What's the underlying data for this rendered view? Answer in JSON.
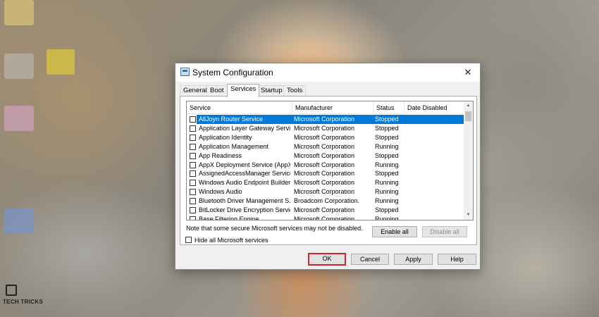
{
  "watermark": {
    "title": "TECH TRICKS",
    "subtitle": ""
  },
  "dialog": {
    "title": "System Configuration",
    "close_glyph": "✕",
    "tabs": [
      "General",
      "Boot",
      "Services",
      "Startup",
      "Tools"
    ],
    "active_tab": "Services",
    "columns": [
      "Service",
      "Manufacturer",
      "Status",
      "Date Disabled"
    ],
    "services": [
      {
        "service": "AllJoyn Router Service",
        "manufacturer": "Microsoft Corporation",
        "status": "Stopped",
        "date_disabled": "",
        "selected": true
      },
      {
        "service": "Application Layer Gateway Service",
        "manufacturer": "Microsoft Corporation",
        "status": "Stopped",
        "date_disabled": ""
      },
      {
        "service": "Application Identity",
        "manufacturer": "Microsoft Corporation",
        "status": "Stopped",
        "date_disabled": ""
      },
      {
        "service": "Application Management",
        "manufacturer": "Microsoft Corporation",
        "status": "Running",
        "date_disabled": ""
      },
      {
        "service": "App Readiness",
        "manufacturer": "Microsoft Corporation",
        "status": "Stopped",
        "date_disabled": ""
      },
      {
        "service": "AppX Deployment Service (AppX...",
        "manufacturer": "Microsoft Corporation",
        "status": "Running",
        "date_disabled": ""
      },
      {
        "service": "AssignedAccessManager Service",
        "manufacturer": "Microsoft Corporation",
        "status": "Stopped",
        "date_disabled": ""
      },
      {
        "service": "Windows Audio Endpoint Builder",
        "manufacturer": "Microsoft Corporation",
        "status": "Running",
        "date_disabled": ""
      },
      {
        "service": "Windows Audio",
        "manufacturer": "Microsoft Corporation",
        "status": "Running",
        "date_disabled": ""
      },
      {
        "service": "Bluetooth Driver Management S...",
        "manufacturer": "Broadcom Corporation.",
        "status": "Running",
        "date_disabled": ""
      },
      {
        "service": "BitLocker Drive Encryption Service",
        "manufacturer": "Microsoft Corporation",
        "status": "Stopped",
        "date_disabled": ""
      },
      {
        "service": "Base Filtering Engine",
        "manufacturer": "Microsoft Corporation",
        "status": "Running",
        "date_disabled": ""
      }
    ],
    "note": "Note that some secure Microsoft services may not be disabled.",
    "enable_all_label": "Enable all",
    "disable_all_label": "Disable all",
    "hide_ms_label": "Hide all Microsoft services",
    "ok_label": "OK",
    "cancel_label": "Cancel",
    "apply_label": "Apply",
    "help_label": "Help",
    "selection_color": "#0078d7",
    "highlight_color": "#d0262b"
  }
}
